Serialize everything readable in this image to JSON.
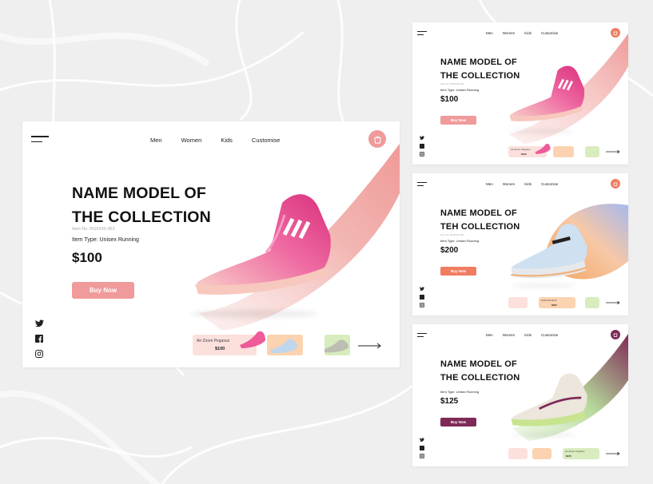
{
  "colors": {
    "pink_accent": "#f09a9b",
    "orange_accent": "#f07d62",
    "purple_accent": "#7e2a57",
    "text_dark": "#111111"
  },
  "main": {
    "nav": [
      "Men",
      "Women",
      "Kids",
      "Customise"
    ],
    "title_line1": "NAME MODEL OF",
    "title_line2": "THE COLLECTION",
    "item_no": "Item No. BG5643-453",
    "item_type": "Item Type: Unisex Running",
    "price": "$100",
    "buy_label": "Buy Now",
    "thumb1_label": "Air Zoom Pegasus",
    "thumb1_price": "$100"
  },
  "s1": {
    "nav": [
      "Men",
      "Women",
      "Kids",
      "Customise"
    ],
    "title_line1": "NAME MODEL OF",
    "title_line2": "THE COLLECTION",
    "item_no": "Item No. BG5643-453",
    "item_type": "Item Type: Unisex Running",
    "price": "$100",
    "buy_label": "Buy Now",
    "thumb1_label": "Air Zoom Pegasus",
    "thumb1_price": "$100"
  },
  "s2": {
    "nav": [
      "Men",
      "Women",
      "Kids",
      "Customise"
    ],
    "title_line1": "NAME MODEL OF",
    "title_line2": "TEH COLLECTION",
    "item_no": "Item No. BG5643-453",
    "item_type": "Item Type: Unisex Running",
    "price": "$200",
    "buy_label": "Buy Now",
    "thumb2_label": "HOKA Bondi 8",
    "thumb2_price": "$200"
  },
  "s3": {
    "nav": [
      "Men",
      "Women",
      "Kids",
      "Customise"
    ],
    "title_line1": "NAME MODEL OF",
    "title_line2": "THE COLLECTION",
    "item_type": "Item Type: Unisex Running",
    "price": "$125",
    "buy_label": "Buy Now",
    "thumb3_label": "Air Zoom Pegasus",
    "thumb3_price": "$125"
  }
}
